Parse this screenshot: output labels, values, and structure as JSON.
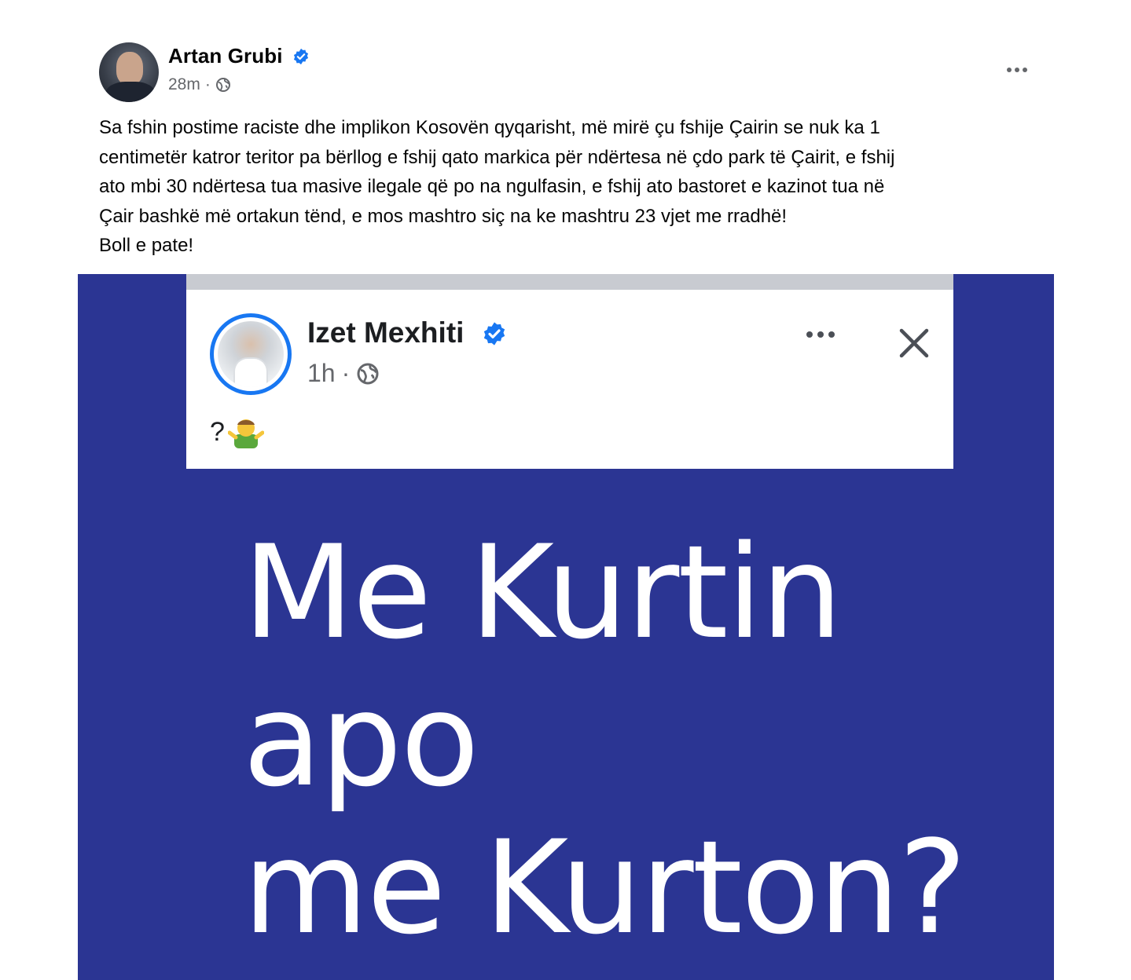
{
  "post": {
    "author": "Artan Grubi",
    "time": "28m",
    "separator": "·",
    "text_lines": [
      "Sa fshin postime raciste dhe implikon Kosovën qyqarisht, më mirë çu fshije Çairin se nuk ka 1",
      "centimetër katror teritor pa bërllog e fshij qato markica për ndërtesa në çdo park të Çairit, e fshij",
      "ato mbi 30 ndërtesa tua masive ilegale që po na ngulfasin, e fshij ato bastoret e kazinot tua në",
      "Çair bashkë më ortakun tënd, e mos mashtro siç na ke mashtru 23 vjet me rradhë!",
      "Boll e pate!"
    ]
  },
  "image": {
    "shared_post": {
      "author": "Izet Mexhiti",
      "time": "1h",
      "separator": "·",
      "text": "?"
    },
    "headline_lines": [
      "Me Kurtin",
      "apo",
      "me Kurton?"
    ]
  },
  "colors": {
    "verified": "#1877f2",
    "image_background": "#2b3593",
    "meta_text": "#65676b"
  },
  "icons": {
    "verified": "verified-badge-icon",
    "audience": "globe-icon",
    "more": "more-options-icon",
    "close": "close-icon",
    "emoji": "person-shrugging-emoji"
  }
}
